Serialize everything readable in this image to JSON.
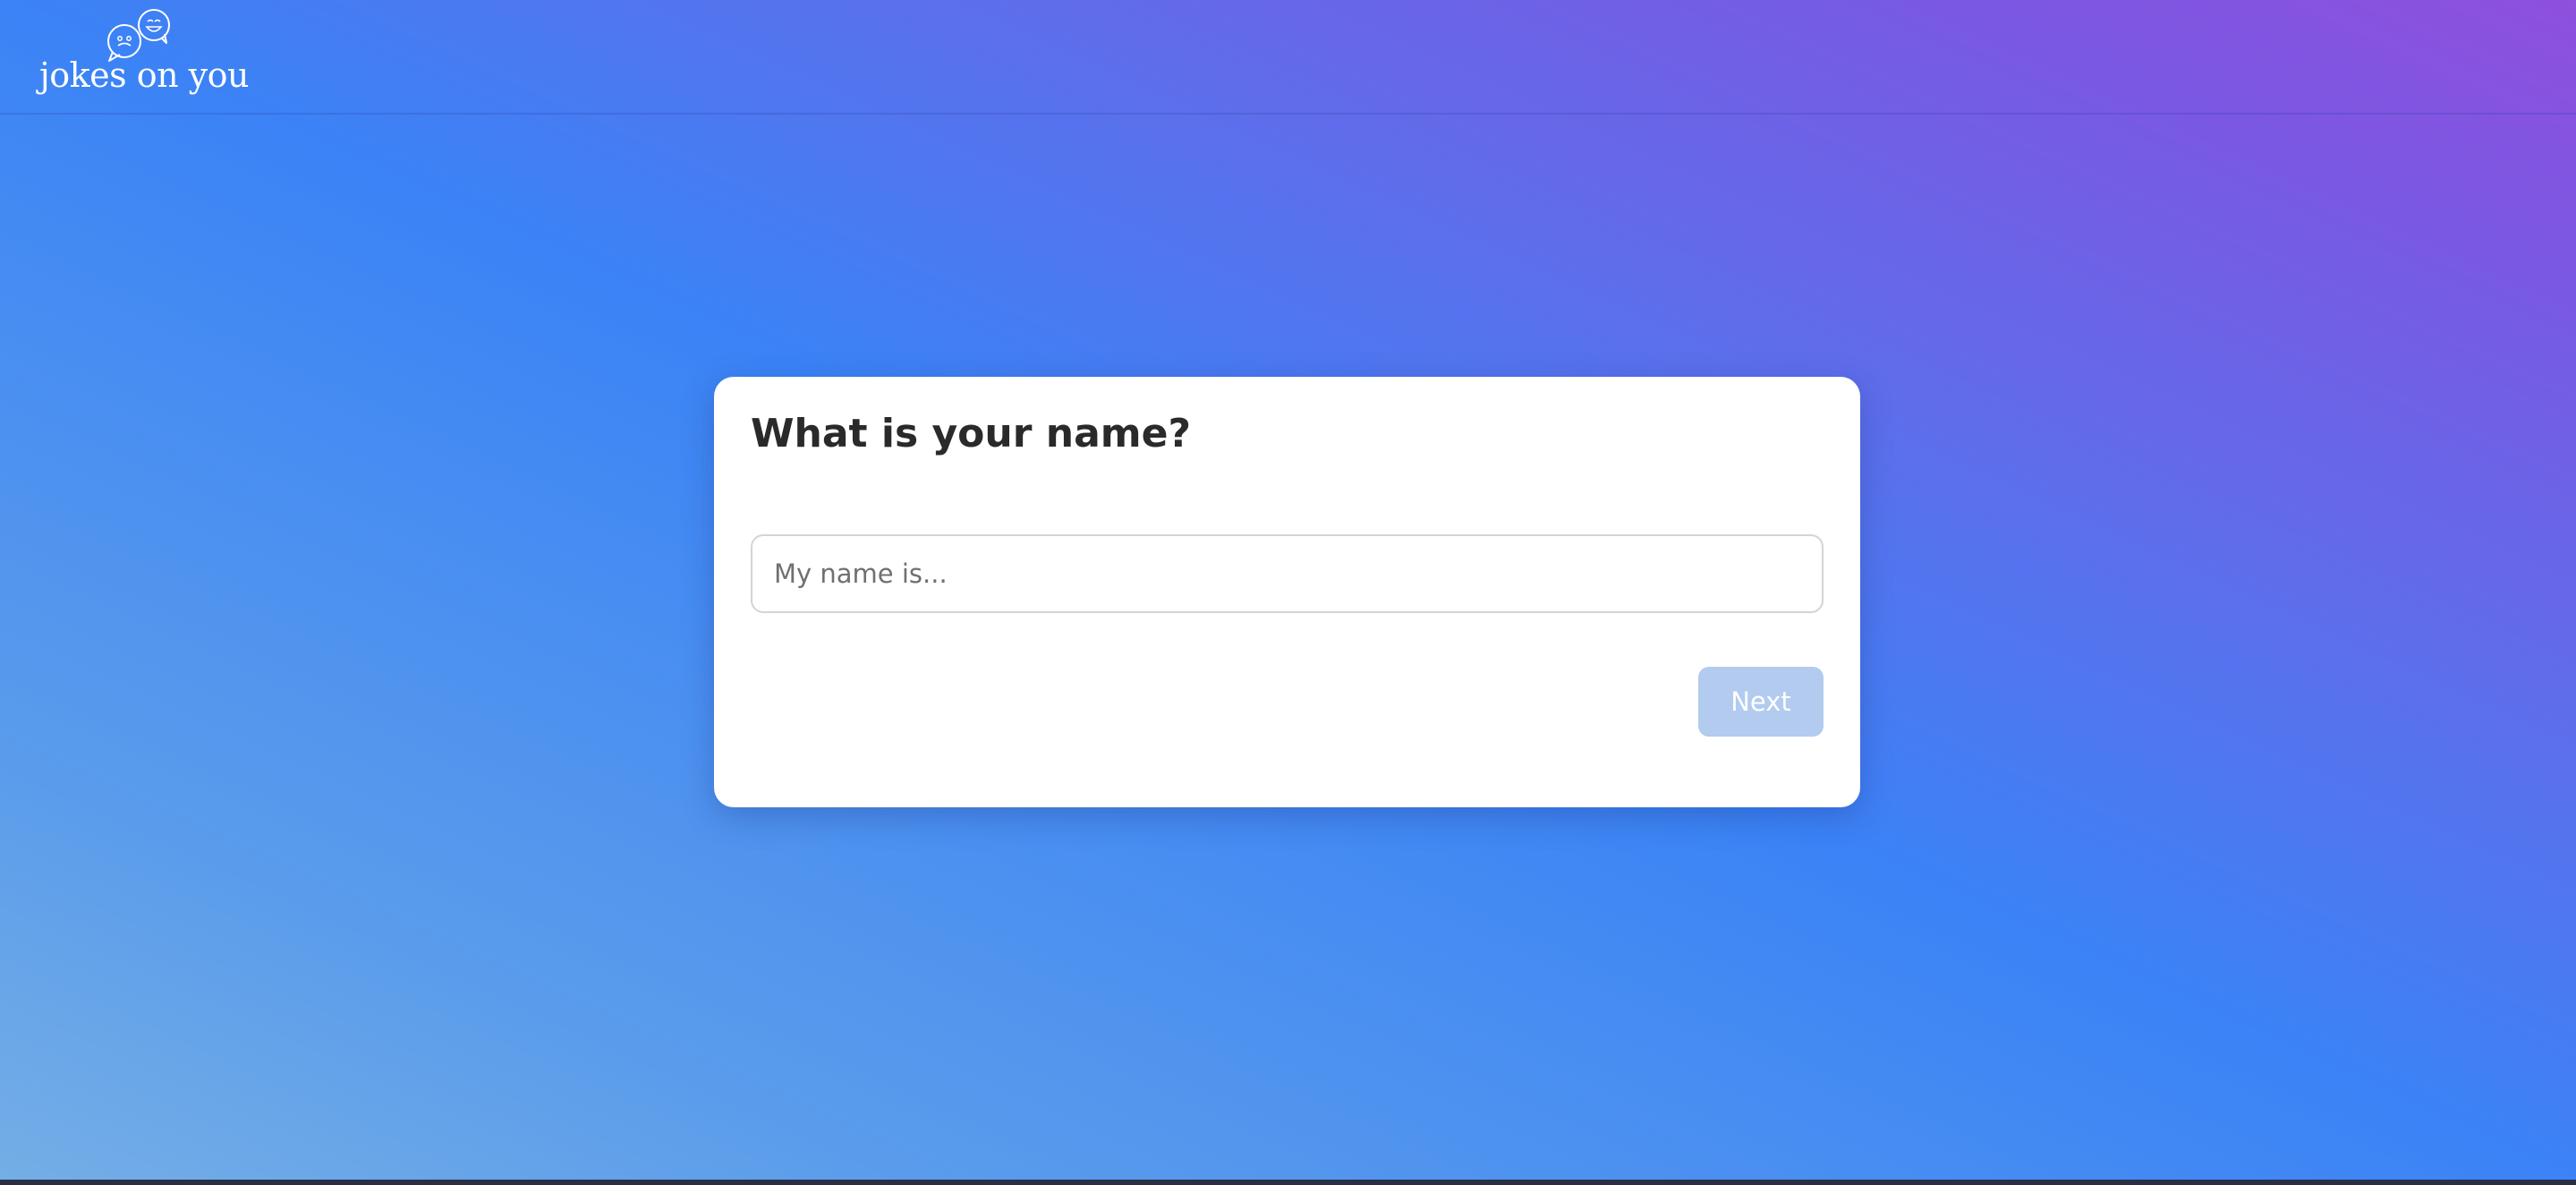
{
  "header": {
    "logo_text": "jokes on you",
    "logo_icon": "speech-bubbles-faces-icon"
  },
  "card": {
    "title": "What is your name?",
    "name_input": {
      "value": "",
      "placeholder": "My name is..."
    },
    "next_label": "Next"
  },
  "colors": {
    "gradient_start": "#75aee6",
    "gradient_mid": "#3b83f6",
    "gradient_end": "#8e50dd",
    "card_background": "#ffffff",
    "button_disabled": "#b2cbef",
    "title_text": "#2a2a2a"
  }
}
